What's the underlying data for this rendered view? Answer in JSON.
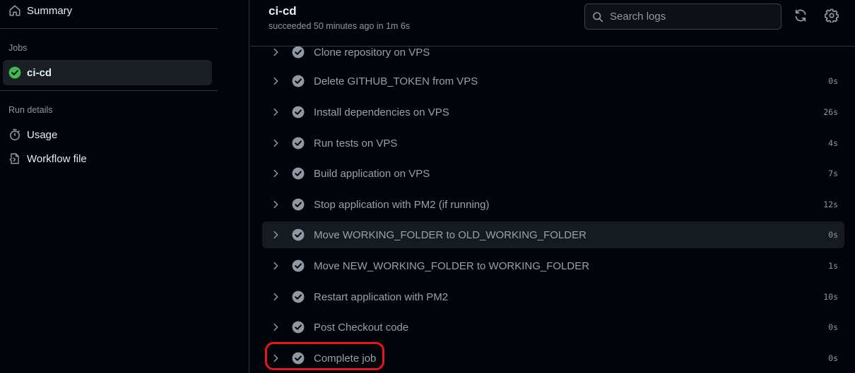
{
  "sidebar": {
    "summary_label": "Summary",
    "jobs_heading": "Jobs",
    "job_label": "ci-cd",
    "run_details_heading": "Run details",
    "usage_label": "Usage",
    "workflow_file_label": "Workflow file"
  },
  "header": {
    "title": "ci-cd",
    "subtitle": "succeeded 50 minutes ago in 1m 6s",
    "search_placeholder": "Search logs"
  },
  "steps": [
    {
      "name": "Clone repository on VPS",
      "duration": ""
    },
    {
      "name": "Delete GITHUB_TOKEN from VPS",
      "duration": "0s"
    },
    {
      "name": "Install dependencies on VPS",
      "duration": "26s"
    },
    {
      "name": "Run tests on VPS",
      "duration": "4s"
    },
    {
      "name": "Build application on VPS",
      "duration": "7s"
    },
    {
      "name": "Stop application with PM2 (if running)",
      "duration": "12s"
    },
    {
      "name": "Move WORKING_FOLDER to OLD_WORKING_FOLDER",
      "duration": "0s"
    },
    {
      "name": "Move NEW_WORKING_FOLDER to WORKING_FOLDER",
      "duration": "1s"
    },
    {
      "name": "Restart application with PM2",
      "duration": "10s"
    },
    {
      "name": "Post Checkout code",
      "duration": "0s"
    },
    {
      "name": "Complete job",
      "duration": "0s"
    }
  ],
  "icons": {
    "summary": "home-icon",
    "job_status": "check-circle-filled-icon",
    "usage": "stopwatch-icon",
    "workflow_file": "workflow-file-icon",
    "search": "search-icon",
    "refresh": "sync-icon",
    "settings": "gear-icon",
    "step_expand": "chevron-right-icon",
    "step_status": "check-circle-icon"
  },
  "colors": {
    "success": "#3fb950",
    "step_check": "#9198a1",
    "highlight_ring": "#e5171e",
    "hover_row": "#161b22"
  }
}
